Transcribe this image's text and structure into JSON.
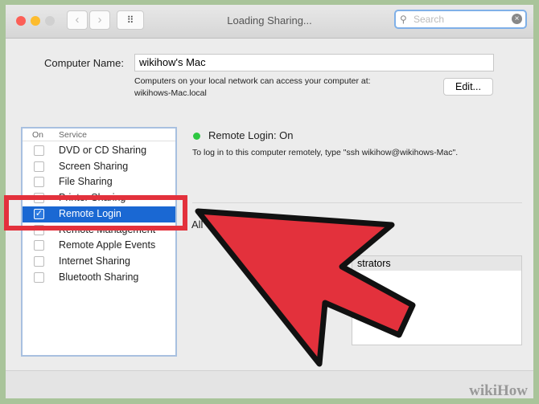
{
  "window": {
    "title": "Loading Sharing...",
    "search_placeholder": "Search"
  },
  "computer_name": {
    "label": "Computer Name:",
    "value": "wikihow's Mac",
    "info": "Computers on your local network can access your computer at:",
    "address": "wikihows-Mac.local",
    "edit_label": "Edit..."
  },
  "services": {
    "col_on": "On",
    "col_service": "Service",
    "items": [
      {
        "label": "DVD or CD Sharing",
        "checked": false
      },
      {
        "label": "Screen Sharing",
        "checked": false
      },
      {
        "label": "File Sharing",
        "checked": false
      },
      {
        "label": "Printer Sharing",
        "checked": false
      },
      {
        "label": "Remote Login",
        "checked": true,
        "selected": true
      },
      {
        "label": "Remote Management",
        "checked": false
      },
      {
        "label": "Remote Apple Events",
        "checked": false
      },
      {
        "label": "Internet Sharing",
        "checked": false
      },
      {
        "label": "Bluetooth Sharing",
        "checked": false
      }
    ]
  },
  "status": {
    "title": "Remote Login: On",
    "color": "#2ec742",
    "desc": "To log in to this computer remotely, type \"ssh wikihow@wikihows-Mac\".",
    "allow_partial": "All",
    "users_header": "strators"
  },
  "overlay": {
    "arrow_color": "#e3313c",
    "highlight_color": "#e3313c"
  },
  "watermark": "wikiHow"
}
